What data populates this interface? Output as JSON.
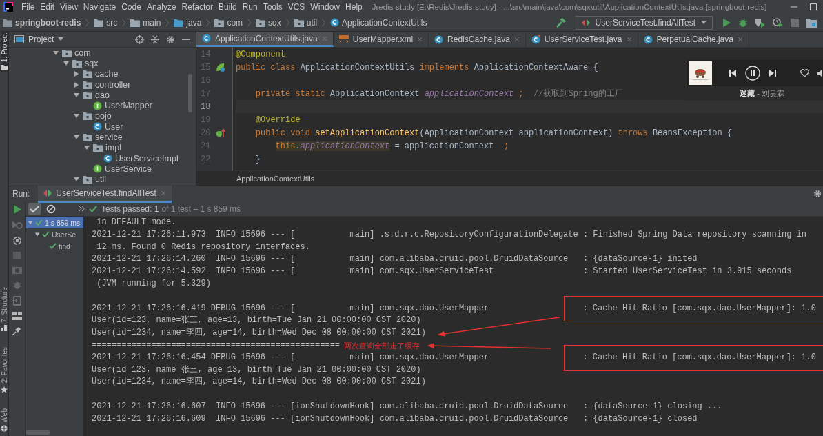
{
  "menu": {
    "items": [
      "File",
      "Edit",
      "View",
      "Navigate",
      "Code",
      "Analyze",
      "Refactor",
      "Build",
      "Run",
      "Tools",
      "VCS",
      "Window",
      "Help"
    ],
    "title": "Jredis-study [E:\\Redis\\Jredis-study] - ...\\src\\main\\java\\com\\sqx\\util\\ApplicationContextUtils.java [springboot-redis]"
  },
  "breadcrumbs": [
    {
      "label": "springboot-redis",
      "kind": "module"
    },
    {
      "label": "src",
      "kind": "folder"
    },
    {
      "label": "main",
      "kind": "folder"
    },
    {
      "label": "java",
      "kind": "source"
    },
    {
      "label": "com",
      "kind": "package"
    },
    {
      "label": "sqx",
      "kind": "package"
    },
    {
      "label": "util",
      "kind": "package"
    },
    {
      "label": "ApplicationContextUtils",
      "kind": "class"
    }
  ],
  "run_config": {
    "label": "UserServiceTest.findAllTest"
  },
  "tool_stripe": [
    {
      "label": "1: Project",
      "kind": "project",
      "selected": true
    },
    {
      "label": "7: Structure",
      "kind": "structure",
      "selected": false
    },
    {
      "label": "2: Favorites",
      "kind": "favorites",
      "selected": false
    },
    {
      "label": "Web",
      "kind": "web",
      "selected": false
    }
  ],
  "project": {
    "title": "Project",
    "tree": [
      {
        "label": "com",
        "kind": "folder",
        "expanded": true,
        "children": [
          {
            "label": "sqx",
            "kind": "folder",
            "expanded": true,
            "children": [
              {
                "label": "cache",
                "kind": "folder",
                "expanded": false
              },
              {
                "label": "controller",
                "kind": "folder",
                "expanded": false
              },
              {
                "label": "dao",
                "kind": "folder",
                "expanded": true,
                "children": [
                  {
                    "label": "UserMapper",
                    "kind": "interface"
                  }
                ]
              },
              {
                "label": "pojo",
                "kind": "folder",
                "expanded": true,
                "children": [
                  {
                    "label": "User",
                    "kind": "class"
                  }
                ]
              },
              {
                "label": "service",
                "kind": "folder",
                "expanded": true,
                "children": [
                  {
                    "label": "impl",
                    "kind": "folder",
                    "expanded": true,
                    "children": [
                      {
                        "label": "UserServiceImpl",
                        "kind": "class"
                      }
                    ]
                  },
                  {
                    "label": "UserService",
                    "kind": "interface"
                  }
                ]
              },
              {
                "label": "util",
                "kind": "folder",
                "expanded": true
              }
            ]
          }
        ]
      }
    ]
  },
  "editor": {
    "tabs": [
      {
        "label": "ApplicationContextUtils.java",
        "kind": "class",
        "selected": true
      },
      {
        "label": "UserMapper.xml",
        "kind": "xml",
        "selected": false
      },
      {
        "label": "RedisCache.java",
        "kind": "class",
        "selected": false
      },
      {
        "label": "UserServiceTest.java",
        "kind": "test",
        "selected": false
      },
      {
        "label": "PerpetualCache.java",
        "kind": "class",
        "selected": false
      }
    ],
    "lines": [
      {
        "number": "14",
        "kind": "top",
        "current": false,
        "tokens": [
          {
            "kind": "annotation",
            "text": "@Component"
          }
        ]
      },
      {
        "number": "15",
        "kind": "top",
        "current": false,
        "gutter": {
          "kind": "bean"
        },
        "tokens": [
          {
            "kind": "keyword",
            "text": "public class "
          },
          {
            "kind": "plain",
            "text": "ApplicationContextUtils "
          },
          {
            "kind": "keyword",
            "text": "implements "
          },
          {
            "kind": "plain",
            "text": "ApplicationContextAware {"
          }
        ]
      },
      {
        "number": "16",
        "current": false
      },
      {
        "number": "17",
        "kind": "member",
        "current": false,
        "tokens": [
          {
            "kind": "keyword",
            "text": "private static "
          },
          {
            "kind": "plain",
            "text": "ApplicationContext "
          },
          {
            "kind": "field",
            "text": "applicationContext"
          },
          {
            "kind": "keyword",
            "text": " ;  "
          },
          {
            "kind": "comment",
            "text": "//获取到Spring的工厂"
          }
        ]
      },
      {
        "number": "18",
        "current": true
      },
      {
        "number": "19",
        "kind": "member",
        "current": false,
        "tokens": [
          {
            "kind": "annotation",
            "text": "@Override"
          }
        ]
      },
      {
        "number": "20",
        "kind": "member",
        "current": false,
        "gutter": {
          "kind": "override"
        },
        "tokens": [
          {
            "kind": "keyword",
            "text": "public void "
          },
          {
            "kind": "method",
            "text": "setApplicationContext"
          },
          {
            "kind": "plain",
            "text": "(ApplicationContext applicationContext) "
          },
          {
            "kind": "keyword",
            "text": "throws "
          },
          {
            "kind": "plain",
            "text": "BeansException {"
          }
        ]
      },
      {
        "number": "21",
        "kind": "body",
        "current": false,
        "tokens": [
          {
            "kind": "marked_keyword",
            "text": "this"
          },
          {
            "kind": "marked_plain",
            "text": "."
          },
          {
            "kind": "marked_field",
            "text": "applicationContext"
          },
          {
            "kind": "plain",
            "text": " = applicationContext  "
          },
          {
            "kind": "keyword",
            "text": ";"
          }
        ]
      },
      {
        "number": "22",
        "kind": "member",
        "current": false,
        "tokens": [
          {
            "kind": "plain",
            "text": "}"
          }
        ]
      }
    ],
    "breadcrumb": "ApplicationContextUtils"
  },
  "music_widget": {
    "caption": "**迷藏** - 刘昊霖"
  },
  "run": {
    "label": "Run:",
    "tab": {
      "label": "UserServiceTest.findAllTest",
      "selected": true
    },
    "filters": [
      {
        "kind": "passed",
        "on": true
      },
      {
        "kind": "ignored",
        "on": false
      }
    ],
    "status": "Tests passed: 1",
    "status_detail": "of 1 test – 1 s 859 ms",
    "tree": [
      {
        "label": "1 s 859 ms",
        "selected": true,
        "expanded": true,
        "children": [
          {
            "label": "UserSe",
            "selected": false,
            "expanded": true,
            "children": [
              {
                "label": "find",
                "selected": false
              }
            ]
          }
        ]
      }
    ],
    "console": [
      {
        "kind": "log",
        "text": " in DEFAULT mode."
      },
      {
        "kind": "log",
        "text": "2021-12-21 17:26:11.973  INFO 15696 --- [           main] .s.d.r.c.RepositoryConfigurationDelegate : Finished Spring Data repository scanning in"
      },
      {
        "kind": "log",
        "text": " 12 ms. Found 0 Redis repository interfaces."
      },
      {
        "kind": "log",
        "text": "2021-12-21 17:26:14.260  INFO 15696 --- [           main] com.alibaba.druid.pool.DruidDataSource   : {dataSource-1} inited"
      },
      {
        "kind": "log",
        "text": "2021-12-21 17:26:14.592  INFO 15696 --- [           main] com.sqx.UserServiceTest                  : Started UserServiceTest in 3.915 seconds"
      },
      {
        "kind": "log",
        "text": " (JVM running for 5.329)"
      },
      {
        "kind": "blank"
      },
      {
        "kind": "framed",
        "text": "2021-12-21 17:26:16.419 DEBUG 15696 --- [           main] com.sqx.dao.UserMapper",
        "framed": ": Cache Hit Ratio [com.sqx.dao.UserMapper]: 1.0"
      },
      {
        "kind": "log",
        "text": "User(id=123, name=张三, age=13, birth=Tue Jan 21 00:00:00 CST 2020)"
      },
      {
        "kind": "log",
        "text": "User(id=1234, name=李四, age=14, birth=Wed Dec 08 00:00:00 CST 2021)"
      },
      {
        "kind": "log",
        "text": "=================================================="
      },
      {
        "kind": "framed",
        "text": "2021-12-21 17:26:16.454 DEBUG 15696 --- [           main] com.sqx.dao.UserMapper",
        "framed": ": Cache Hit Ratio [com.sqx.dao.UserMapper]: 1.0"
      },
      {
        "kind": "log",
        "text": "User(id=123, name=张三, age=13, birth=Tue Jan 21 00:00:00 CST 2020)"
      },
      {
        "kind": "log",
        "text": "User(id=1234, name=李四, age=14, birth=Wed Dec 08 00:00:00 CST 2021)"
      },
      {
        "kind": "blank"
      },
      {
        "kind": "log",
        "text": "2021-12-21 17:26:16.607  INFO 15696 --- [ionShutdownHook] com.alibaba.druid.pool.DruidDataSource   : {dataSource-1} closing ..."
      },
      {
        "kind": "log",
        "text": "2021-12-21 17:26:16.609  INFO 15696 --- [ionShutdownHook] com.alibaba.druid.pool.DruidDataSource   : {dataSource-1} closed"
      }
    ],
    "annotation": {
      "note": "两次查询全部走了缓存"
    }
  }
}
